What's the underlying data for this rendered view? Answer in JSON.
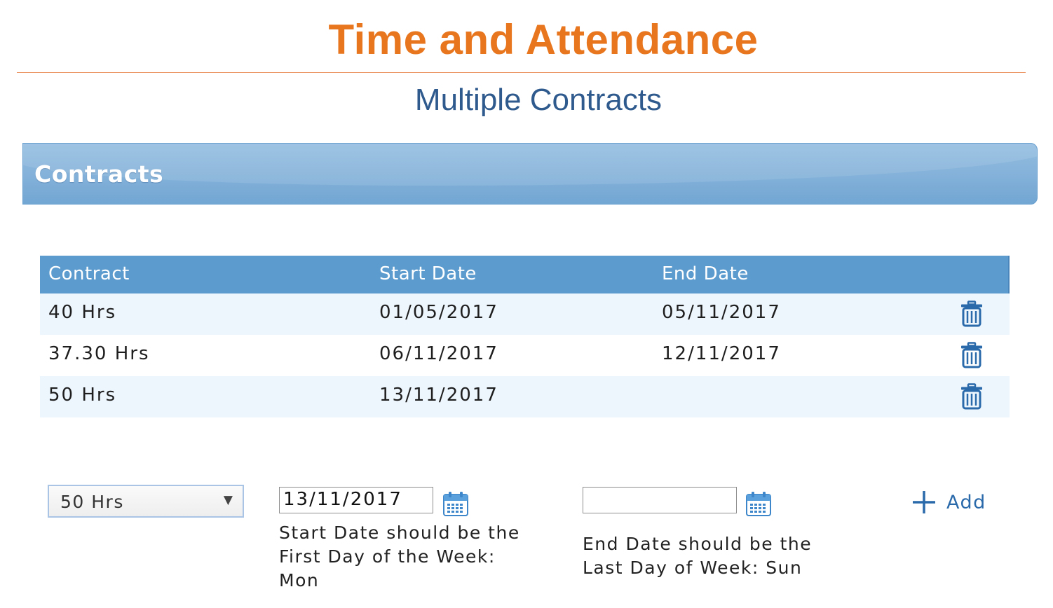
{
  "page": {
    "title": "Time and Attendance",
    "subtitle": "Multiple Contracts"
  },
  "panel": {
    "title": "Contracts"
  },
  "table": {
    "headers": {
      "contract": "Contract",
      "start_date": "Start Date",
      "end_date": "End Date"
    },
    "rows": [
      {
        "contract": "40 Hrs",
        "start_date": "01/05/2017",
        "end_date": "05/11/2017",
        "action_icon": "trash-icon"
      },
      {
        "contract": "37.30 Hrs",
        "start_date": "06/11/2017",
        "end_date": "12/11/2017",
        "action_icon": "trash-icon"
      },
      {
        "contract": "50 Hrs",
        "start_date": "13/11/2017",
        "end_date": "",
        "action_icon": "trash-icon"
      }
    ]
  },
  "form": {
    "contract_select": {
      "value": "50 Hrs"
    },
    "start_date": {
      "value": "13/11/2017",
      "icon": "calendar-icon",
      "hint_lines": [
        "Start Date should be the",
        "First Day of the Week:",
        "Mon"
      ]
    },
    "end_date": {
      "value": "",
      "icon": "calendar-icon",
      "hint_lines": [
        "End Date should be the",
        "Last Day of Week: Sun"
      ]
    },
    "add_button": {
      "label": "Add",
      "icon": "plus-icon"
    }
  },
  "colors": {
    "title": "#e8761e",
    "subtitle": "#2f5a8e",
    "header_blue": "#5b9bce",
    "icon_blue": "#2a6aab",
    "row_alt": "#edf5fd"
  }
}
